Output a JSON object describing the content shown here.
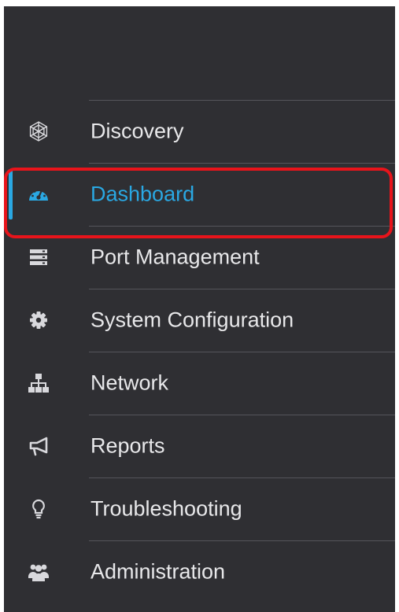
{
  "colors": {
    "sidebar_bg": "#2f2f33",
    "text": "#e8e8ea",
    "accent": "#2aa8e3",
    "annotation_outline": "#e8141b",
    "divider": "#55555b"
  },
  "nav": {
    "items": [
      {
        "label": "Discovery",
        "icon": "globe-mesh-icon",
        "active": false
      },
      {
        "label": "Dashboard",
        "icon": "speedometer-icon",
        "active": true
      },
      {
        "label": "Port Management",
        "icon": "server-rack-icon",
        "active": false
      },
      {
        "label": "System Configuration",
        "icon": "gear-icon",
        "active": false
      },
      {
        "label": "Network",
        "icon": "network-topology-icon",
        "active": false
      },
      {
        "label": "Reports",
        "icon": "megaphone-icon",
        "active": false
      },
      {
        "label": "Troubleshooting",
        "icon": "lightbulb-icon",
        "active": false
      },
      {
        "label": "Administration",
        "icon": "users-icon",
        "active": false
      }
    ]
  }
}
